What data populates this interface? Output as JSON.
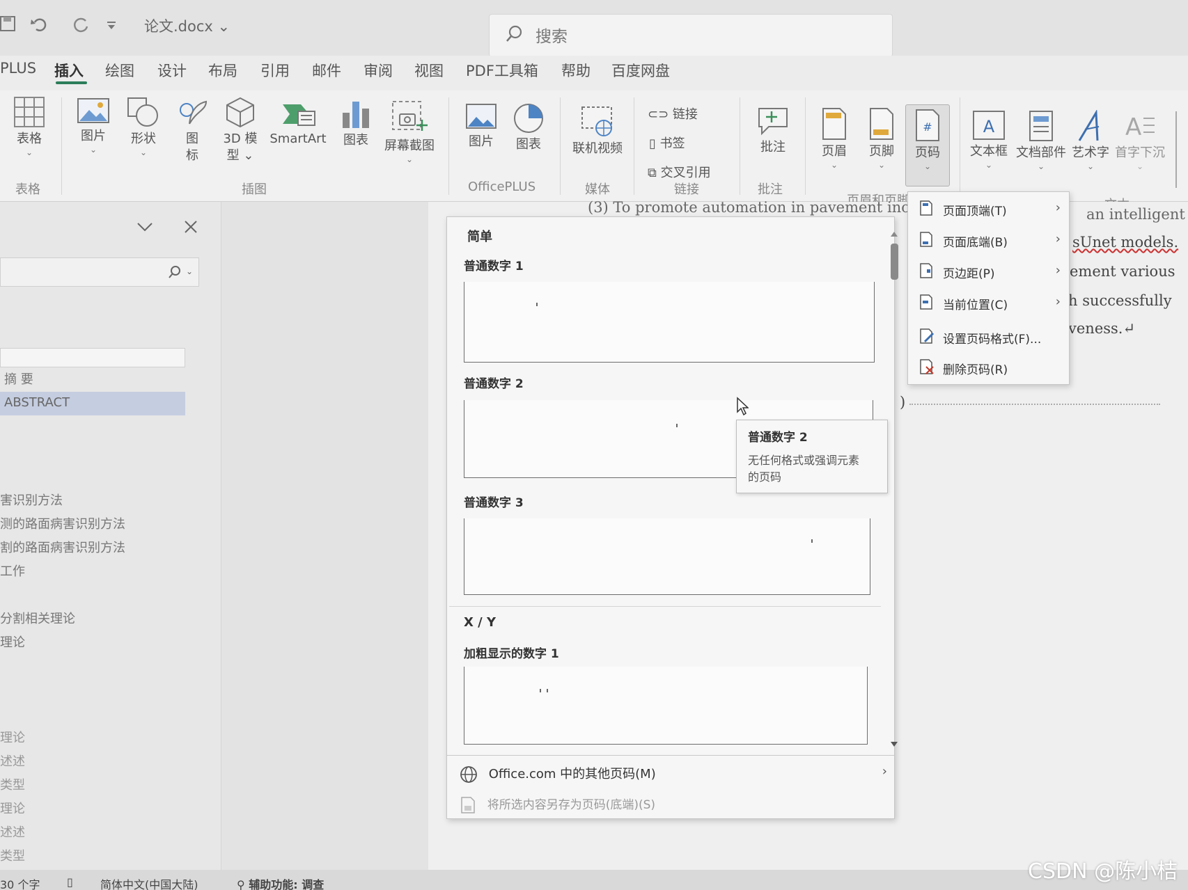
{
  "titlebar": {
    "doc_name": "论文.docx",
    "search_placeholder": "搜索"
  },
  "tabs": [
    "PLUS",
    "插入",
    "绘图",
    "设计",
    "布局",
    "引用",
    "邮件",
    "审阅",
    "视图",
    "PDF工具箱",
    "帮助",
    "百度网盘"
  ],
  "ribbon": {
    "table": "表格",
    "picture": "图片",
    "shapes": "形状",
    "icons_line1": "图",
    "icons_line2": "标",
    "model3d_line1": "3D 模",
    "model3d_line2": "型",
    "smartart": "SmartArt",
    "chart": "图表",
    "screenshot": "屏幕截图",
    "op_picture": "图片",
    "op_chart": "图表",
    "online_video": "联机视频",
    "link": "链接",
    "bookmark": "书签",
    "crossref": "交叉引用",
    "comment": "批注",
    "header": "页眉",
    "footer": "页脚",
    "page_number": "页码",
    "textbox": "文本框",
    "quickparts": "文档部件",
    "wordart": "艺术字",
    "dropcap": "首字下沉",
    "groups": {
      "tables": "表格",
      "illustrations": "插图",
      "officeplus": "OfficePLUS",
      "media": "媒体",
      "links": "链接",
      "comments": "批注",
      "header_footer": "页眉和页脚",
      "text": "文本"
    }
  },
  "nav": {
    "abstract_cn": "摘 要",
    "abstract_en": "ABSTRACT",
    "items": [
      "害识别方法",
      "测的路面病害识别方法",
      "割的路面病害识别方法",
      "工作",
      "分割相关理论",
      "理论",
      "理论",
      "述述",
      "类型",
      "理论",
      "述述",
      "类型"
    ]
  },
  "document": {
    "line0": "(3) To promote automation in pavement inc",
    "line0_right": "an intelligent",
    "line1": "sUnet models.",
    "line2": "ement various",
    "line3": "h successfully",
    "line4": "veness.↵",
    "line5": ")"
  },
  "gallery": {
    "section_simple": "简单",
    "item1": "普通数字 1",
    "item2": "普通数字 2",
    "item3": "普通数字 3",
    "section_xy": "X / Y",
    "item4": "加粗显示的数字 1",
    "more": "Office.com 中的其他页码(M)",
    "save_selection": "将所选内容另存为页码(底端)(S)"
  },
  "tooltip": {
    "title": "普通数字 2",
    "desc_line1": "无任何格式或强调元素",
    "desc_line2": "的页码"
  },
  "menu": {
    "top": "页面顶端(T)",
    "bottom": "页面底端(B)",
    "margins": "页边距(P)",
    "current": "当前位置(C)",
    "format": "设置页码格式(F)...",
    "remove": "删除页码(R)"
  },
  "status": {
    "words": "30 个字",
    "lang": "简体中文(中国大陆)",
    "access": "辅助功能: 调查"
  },
  "watermark": "CSDN @陈小桔",
  "colors": {
    "accent": "#2b7d5a",
    "icon_blue": "#3d6fb0",
    "icon_green": "#3a8f5a"
  }
}
